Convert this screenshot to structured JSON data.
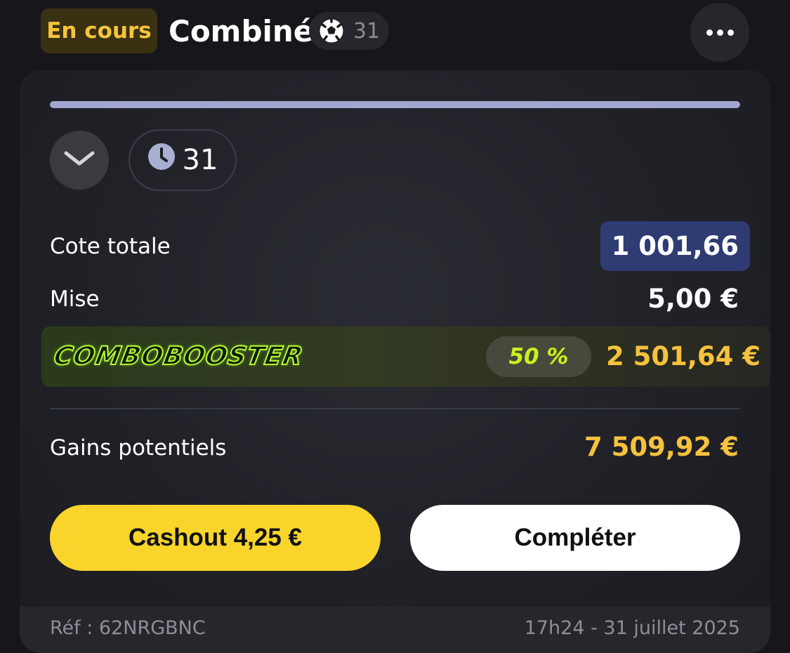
{
  "header": {
    "status_label": "En cours",
    "title": "Combiné",
    "sport_icon": "soccer-ball-icon",
    "selections_count": "31",
    "more_icon": "more-horizontal-icon"
  },
  "card": {
    "progress_fraction": 1.0,
    "expand_icon": "chevron-down-icon",
    "timer_icon": "clock-icon",
    "timer_count": "31",
    "total_odds_label": "Cote totale",
    "total_odds_value": "1 001,66",
    "stake_label": "Mise",
    "stake_value": "5,00 €",
    "booster": {
      "logo_text": "COMBOBOOSTER",
      "percent": "50 %",
      "amount": "2 501,64 €"
    },
    "potential_gains_label": "Gains potentiels",
    "potential_gains_value": "7 509,92 €",
    "cashout_label": "Cashout 4,25 €",
    "complete_label": "Compléter",
    "footer": {
      "reference": "Réf : 62NRGBNC",
      "datetime": "17h24 - 31 juillet 2025"
    }
  },
  "colors": {
    "status_text": "#f4c43b",
    "status_bg": "#3a3012",
    "odds_badge_bg": "#2f3b73",
    "boost_amount": "#f6c13d",
    "boost_percent": "#c9f21a",
    "cashout_bg": "#f9d52b",
    "gains_value": "#f6c13d"
  }
}
